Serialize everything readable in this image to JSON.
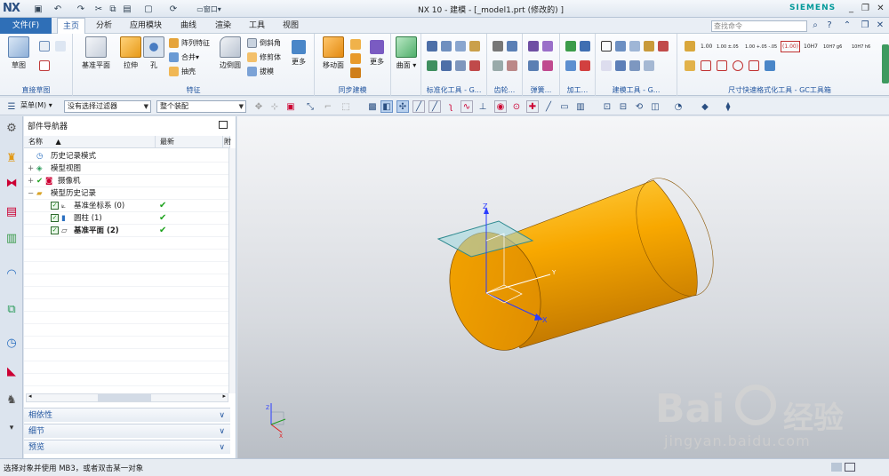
{
  "titlebar": {
    "logo": "NX",
    "window_menu": "窗口",
    "title": "NX 10 - 建模 - [_model1.prt  (修改的) ]",
    "brand": "SIEMENS"
  },
  "menubar": {
    "file": "文件(F)",
    "tabs": [
      "主页",
      "分析",
      "应用模块",
      "曲线",
      "渲染",
      "工具",
      "视图"
    ],
    "search_placeholder": "查找命令"
  },
  "ribbon": {
    "sketch": {
      "label": "草图",
      "group": "直接草图"
    },
    "feature": {
      "datum_plane": "基准平面",
      "extrude": "拉伸",
      "hole": "孔",
      "pattern": "阵列特征",
      "unite": "合并",
      "shell": "抽壳",
      "edge_blend": "边倒圆",
      "chamfer": "倒斜角",
      "trim_body": "修剪体",
      "draft": "拔模",
      "more": "更多",
      "group": "特征"
    },
    "sync": {
      "move_face": "移动面",
      "more": "更多",
      "group": "同步建模"
    },
    "surface": {
      "label": "曲面"
    },
    "groups": {
      "std": "标准化工具 - G...",
      "gear": "齿轮...",
      "spring": "弹簧...",
      "machining": "加工...",
      "modeling_tools": "建模工具 - G...",
      "dim": "尺寸快速格式化工具 - GC工具箱"
    },
    "dim_items": [
      "1.00",
      "1.00 ±.05",
      "1.00 +.05 -.05",
      "1.00 +.05 -.03",
      "(1.00)",
      "10H7",
      "10H7 g6",
      "10H7 h6"
    ]
  },
  "toolbar": {
    "menu": "菜单(M)",
    "filter": "没有选择过滤器",
    "assembly": "整个装配"
  },
  "navigator": {
    "title": "部件导航器",
    "columns": {
      "name": "名称",
      "latest": "最新",
      "extra": "附"
    },
    "rows": [
      {
        "label": "历史记录模式",
        "latest": ""
      },
      {
        "label": "模型视图",
        "latest": ""
      },
      {
        "label": "摄像机",
        "latest": ""
      },
      {
        "label": "模型历史记录",
        "latest": ""
      },
      {
        "label": "基准坐标系 (0)",
        "latest": "✔"
      },
      {
        "label": "圆柱 (1)",
        "latest": "✔"
      },
      {
        "label": "基准平面 (2)",
        "latest": "✔"
      }
    ],
    "sections": [
      "相依性",
      "细节",
      "预览"
    ]
  },
  "viewport": {
    "axis_x": "X",
    "axis_y": "Y",
    "axis_z": "Z",
    "cylinder_color": "#f5a100"
  },
  "status": {
    "text": "选择对象并使用 MB3，或者双击某一对象"
  },
  "watermark": {
    "brand": "Bai",
    "brand2": "经验",
    "url": "jingyan.baidu.com"
  }
}
